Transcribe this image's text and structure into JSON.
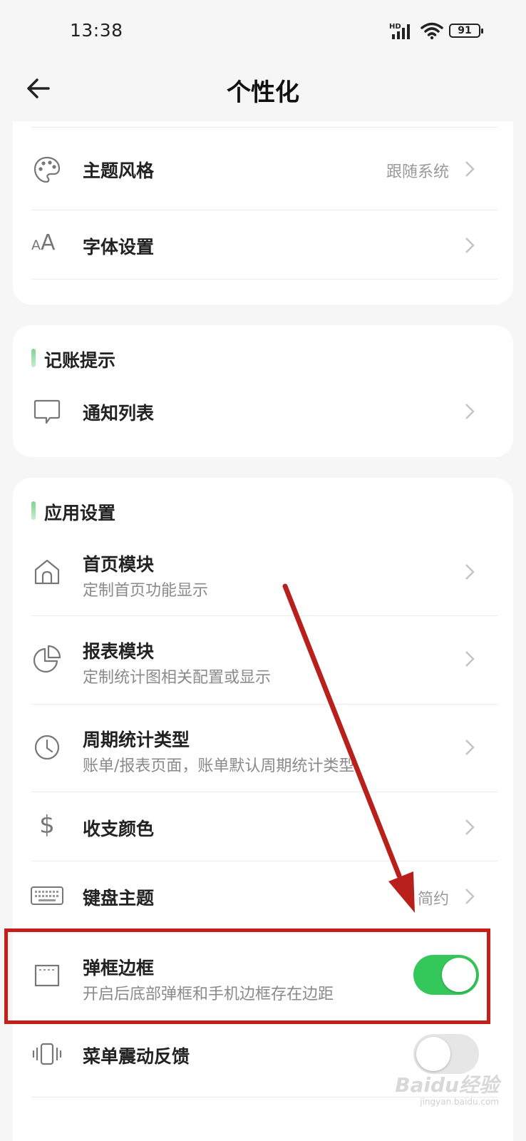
{
  "status_bar": {
    "time": "13:38",
    "network": "HD",
    "battery": "91"
  },
  "header": {
    "title": "个性化"
  },
  "card1": {
    "rows": [
      {
        "label": "主题风格",
        "value": "跟随系统",
        "icon": "palette-icon"
      },
      {
        "label": "字体设置",
        "icon": "font-size-icon"
      }
    ]
  },
  "card2": {
    "section_title": "记账提示",
    "rows": [
      {
        "label": "通知列表",
        "icon": "chat-bubble-icon"
      }
    ]
  },
  "card3": {
    "section_title": "应用设置",
    "rows": [
      {
        "label": "首页模块",
        "sub": "定制首页功能显示",
        "icon": "home-icon"
      },
      {
        "label": "报表模块",
        "sub": "定制统计图相关配置或显示",
        "icon": "pie-chart-icon"
      },
      {
        "label": "周期统计类型",
        "sub": "账单/报表页面，账单默认周期统计类型",
        "icon": "clock-icon"
      },
      {
        "label": "收支颜色",
        "icon": "dollar-icon"
      },
      {
        "label": "键盘主题",
        "value": "简约",
        "icon": "keyboard-icon"
      },
      {
        "label": "弹框边框",
        "sub": "开启后底部弹框和手机边框存在边距",
        "icon": "frame-icon",
        "toggle": true
      },
      {
        "label": "菜单震动反馈",
        "icon": "vibrate-icon",
        "toggle": false
      }
    ]
  },
  "colors": {
    "toggle_on": "#34c85a",
    "toggle_off": "#e6e6e6",
    "annotation": "#c41f1a",
    "accent_bar": "#7fd38f"
  },
  "watermark": {
    "text": "Baidu经验",
    "sub": "jingyan.baidu.com"
  }
}
